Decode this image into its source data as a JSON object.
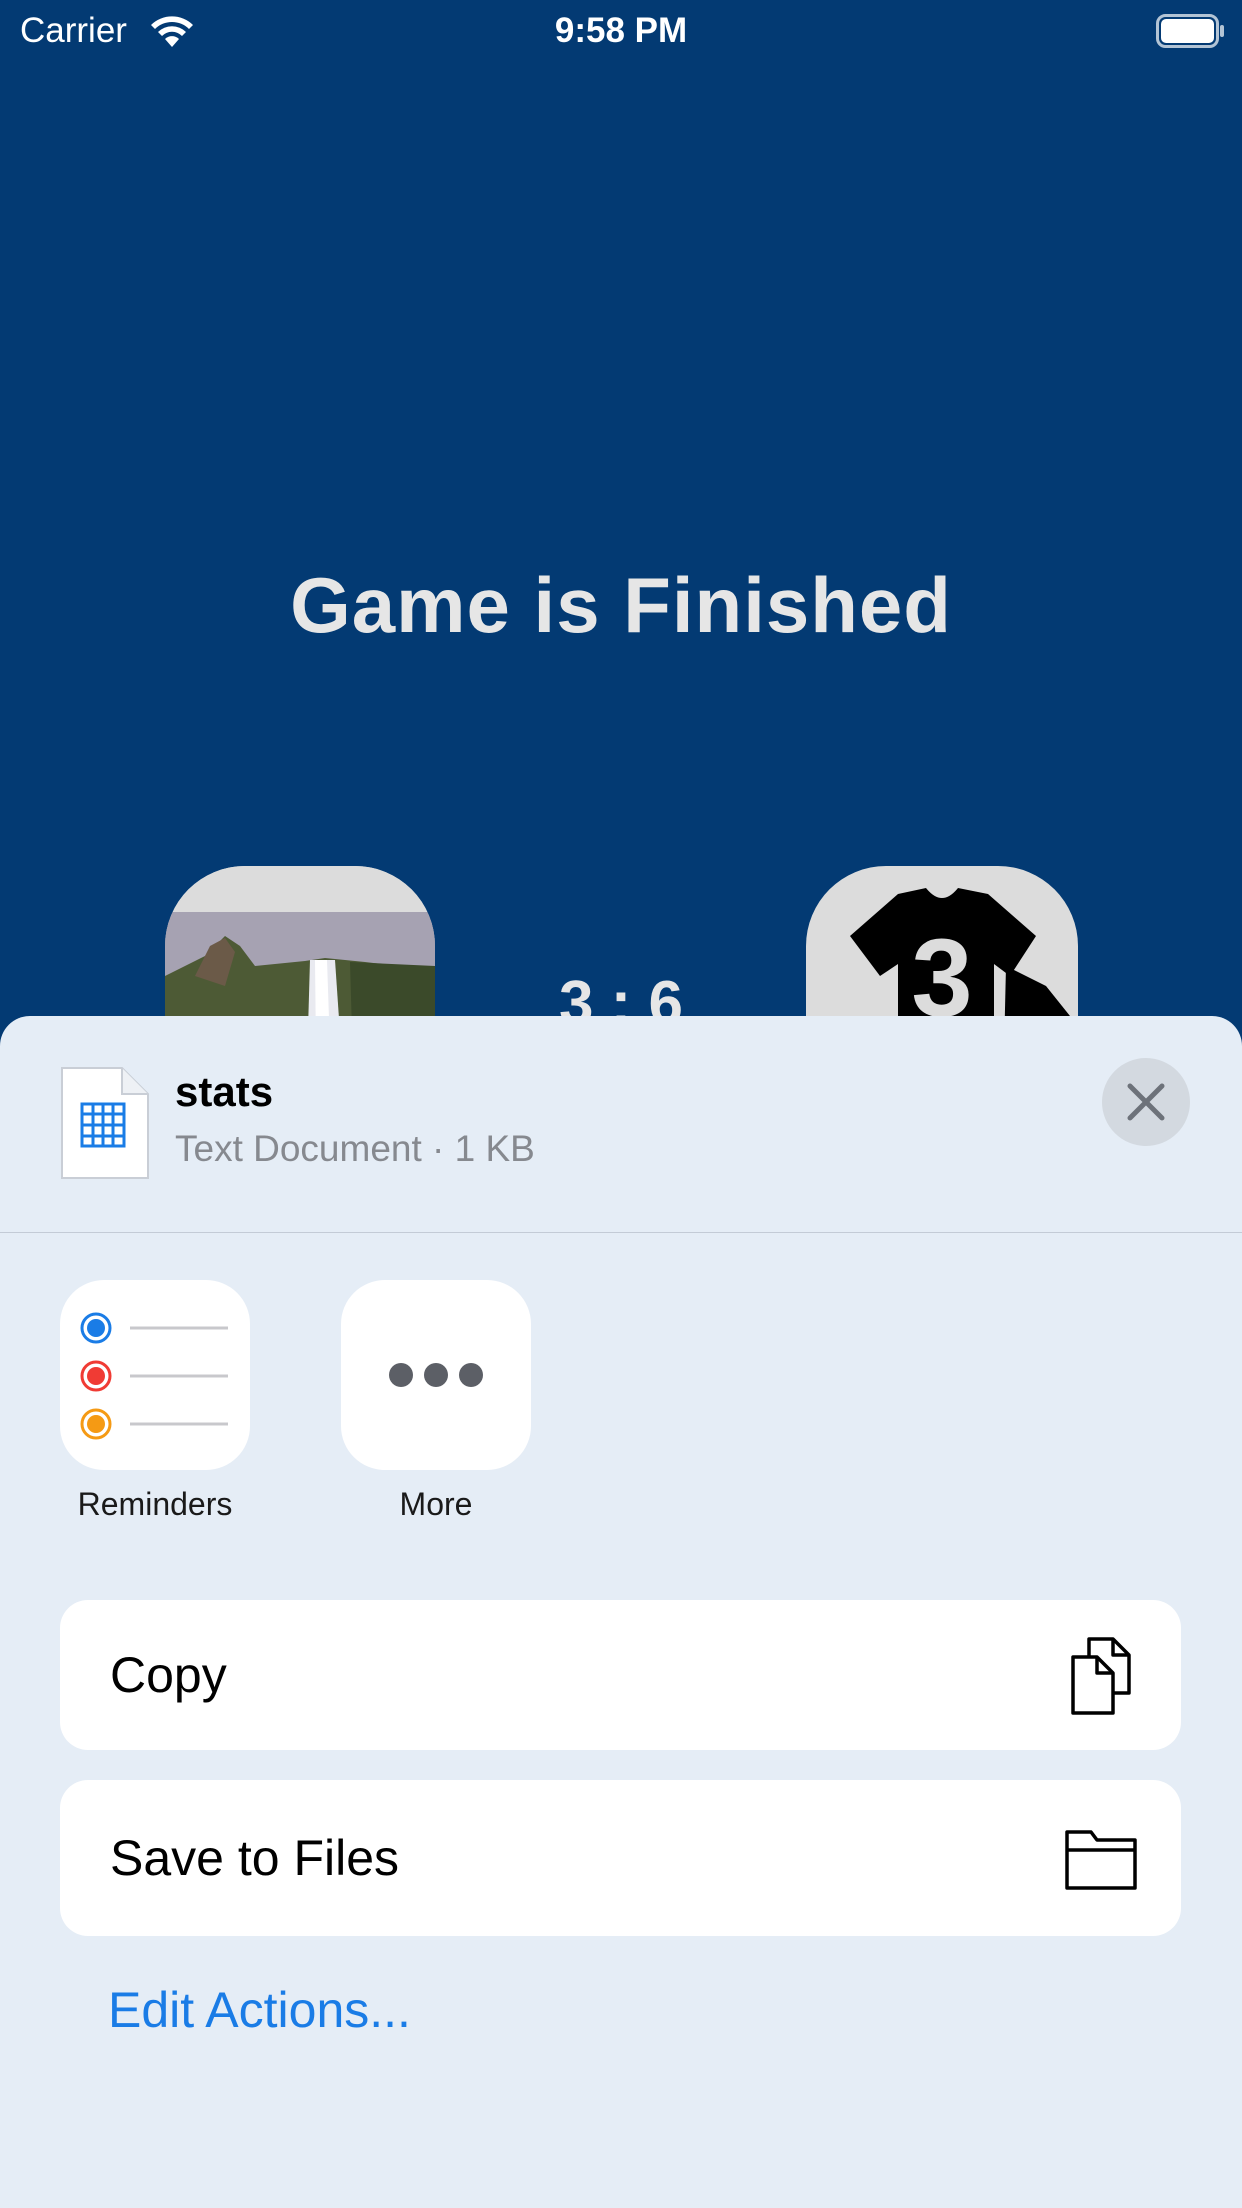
{
  "status_bar": {
    "carrier": "Carrier",
    "time": "9:58 PM"
  },
  "game": {
    "title": "Game is Finished",
    "score": "3 : 6",
    "left_team_image": "waterfall-landscape",
    "right_team_image": "jersey-number-3"
  },
  "share_sheet": {
    "document": {
      "name": "stats",
      "subtitle": "Text Document · 1 KB",
      "icon": "spreadsheet-document-icon"
    },
    "apps": [
      {
        "label": "Reminders",
        "icon": "reminders-icon"
      },
      {
        "label": "More",
        "icon": "more-icon"
      }
    ],
    "actions": [
      {
        "label": "Copy",
        "icon": "copy-icon"
      },
      {
        "label": "Save to Files",
        "icon": "folder-icon"
      }
    ],
    "edit_actions_label": "Edit Actions...",
    "colors": {
      "background": "#033a73",
      "sheet": "#e5edf6",
      "accent": "#1a7ce6"
    }
  }
}
